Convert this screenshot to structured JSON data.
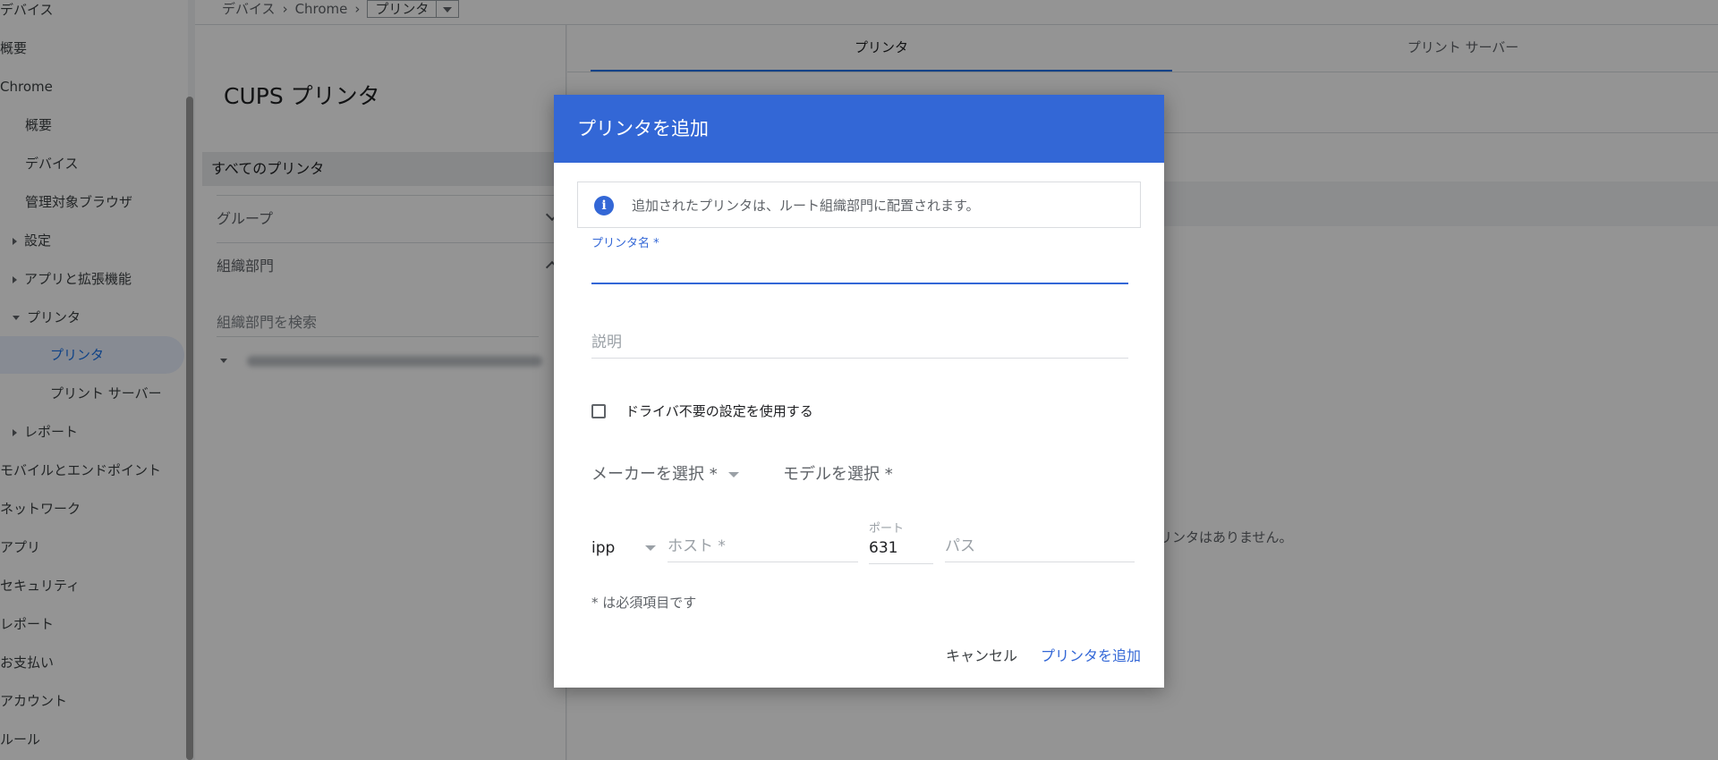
{
  "sidebar": {
    "items": [
      {
        "label": "デバイス"
      },
      {
        "label": "概要"
      },
      {
        "label": "Chrome"
      },
      {
        "label": "概要"
      },
      {
        "label": "デバイス"
      },
      {
        "label": "管理対象ブラウザ"
      },
      {
        "label": "設定"
      },
      {
        "label": "アプリと拡張機能"
      },
      {
        "label": "プリンタ"
      },
      {
        "label": "プリンタ"
      },
      {
        "label": "プリント サーバー"
      },
      {
        "label": "レポート"
      },
      {
        "label": "モバイルとエンドポイント"
      },
      {
        "label": "ネットワーク"
      },
      {
        "label": "アプリ"
      },
      {
        "label": "セキュリティ"
      },
      {
        "label": "レポート"
      },
      {
        "label": "お支払い"
      },
      {
        "label": "アカウント"
      },
      {
        "label": "ルール"
      }
    ]
  },
  "breadcrumb": {
    "items": [
      "デバイス",
      "Chrome"
    ],
    "current": "プリンタ"
  },
  "left_panel": {
    "title": "CUPS プリンタ",
    "all_printers": "すべてのプリンタ",
    "group": "グループ",
    "org_unit": "組織部門",
    "org_search_placeholder": "組織部門を検索"
  },
  "main": {
    "tabs": [
      {
        "label": "プリンタ"
      },
      {
        "label": "プリント サーバー"
      }
    ],
    "empty_message": "プリンタはありません。"
  },
  "dialog": {
    "title": "プリンタを追加",
    "info": "追加されたプリンタは、ルート組織部門に配置されます。",
    "printer_name_label": "プリンタ名 *",
    "printer_name_value": "",
    "description_placeholder": "説明",
    "driverless_label": "ドライバ不要の設定を使用する",
    "driverless_checked": false,
    "manufacturer_placeholder": "メーカーを選択 *",
    "model_placeholder": "モデルを選択 *",
    "protocol": "ipp",
    "host_placeholder": "ホスト *",
    "port_label": "ポート",
    "port_value": "631",
    "path_placeholder": "パス",
    "required_note": "* は必須項目です",
    "cancel_label": "キャンセル",
    "add_label": "プリンタを追加"
  },
  "colors": {
    "accent": "#3367d6",
    "link": "#1a73e8"
  }
}
